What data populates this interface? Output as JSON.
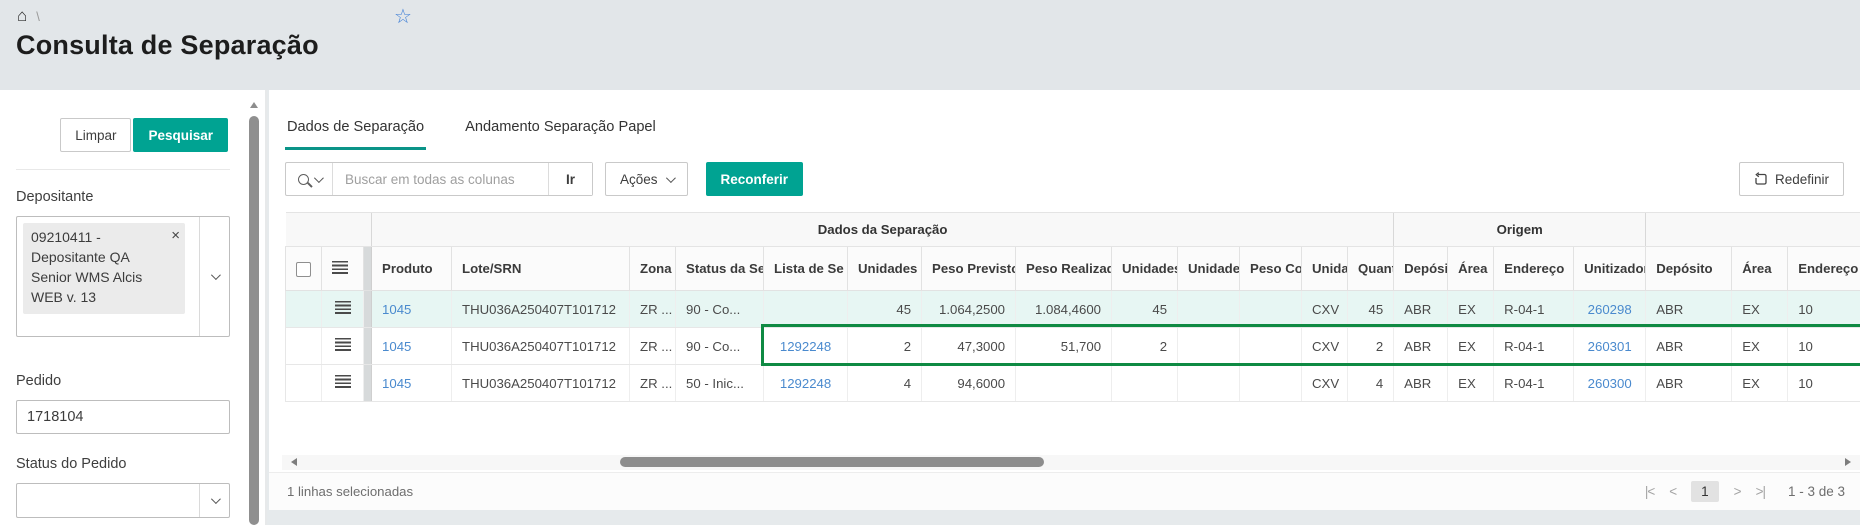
{
  "breadcrumb": {
    "separator": "\\"
  },
  "page": {
    "title": "Consulta de Separação"
  },
  "colors": {
    "accent_teal": "#00a392",
    "tab_underline": "#0a9488",
    "link_blue": "#4a8ace",
    "selection_outline_green": "#0f8a43",
    "selected_row_bg": "#e7f6f3",
    "header_bg": "#e2e6e9"
  },
  "sidebar": {
    "clear_label": "Limpar",
    "search_label": "Pesquisar",
    "depositante": {
      "label": "Depositante",
      "chip": "09210411 - Depositante QA Senior WMS Alcis WEB v. 13"
    },
    "pedido": {
      "label": "Pedido",
      "value": "1718104"
    },
    "status_pedido": {
      "label": "Status do Pedido",
      "value": ""
    }
  },
  "tabs": [
    {
      "label": "Dados de Separação",
      "active": true
    },
    {
      "label": "Andamento Separação Papel",
      "active": false
    }
  ],
  "toolbar": {
    "search_placeholder": "Buscar em todas as colunas",
    "go_label": "Ir",
    "actions_label": "Ações",
    "reconferir_label": "Reconferir",
    "redefinir_label": "Redefinir"
  },
  "table": {
    "groups": [
      {
        "label": "Dados da Separação"
      },
      {
        "label": "Origem"
      },
      {
        "label": ""
      }
    ],
    "columns": [
      {
        "key": "produto",
        "label": "Produto"
      },
      {
        "key": "lote_srn",
        "label": "Lote/SRN"
      },
      {
        "key": "zona",
        "label": "Zona d"
      },
      {
        "key": "status_sep",
        "label": "Status da Sep"
      },
      {
        "key": "lista_sep",
        "label": "Lista de Se"
      },
      {
        "key": "unidades_prev",
        "label": "Unidades P"
      },
      {
        "key": "peso_previsto",
        "label": "Peso Previsto."
      },
      {
        "key": "peso_realizado",
        "label": "Peso Realizado"
      },
      {
        "key": "unidades_conf",
        "label": "Unidades"
      },
      {
        "key": "unidades_2",
        "label": "Unidades"
      },
      {
        "key": "peso_conf",
        "label": "Peso Cor"
      },
      {
        "key": "unidade",
        "label": "Unidad"
      },
      {
        "key": "quantidade",
        "label": "Quant"
      },
      {
        "key": "deposito_origem",
        "label": "Depósit"
      },
      {
        "key": "area_origem",
        "label": "Área"
      },
      {
        "key": "endereco_origem",
        "label": "Endereço"
      },
      {
        "key": "unitizador",
        "label": "Unitizador"
      },
      {
        "key": "deposito_destino",
        "label": "Depósito"
      },
      {
        "key": "area_destino",
        "label": "Área"
      },
      {
        "key": "endereco_destino",
        "label": "Endereço"
      }
    ],
    "rows": [
      {
        "selected": true,
        "cells": {
          "produto": "1045",
          "lote_srn": "THU036A250407T101712",
          "zona": "ZR ...",
          "status_sep": "90 - Co...",
          "lista_sep": "",
          "unidades_prev": "45",
          "peso_previsto": "1.064,2500",
          "peso_realizado": "1.084,4600",
          "unidades_conf": "45",
          "unidades_2": "",
          "peso_conf": "",
          "unidade": "CXV",
          "quantidade": "45",
          "deposito_origem": "ABR",
          "area_origem": "EX",
          "endereco_origem": "R-04-1",
          "unitizador": "260298",
          "deposito_destino": "ABR",
          "area_destino": "EX",
          "endereco_destino": "10"
        }
      },
      {
        "selected": false,
        "highlighted": true,
        "cells": {
          "produto": "1045",
          "lote_srn": "THU036A250407T101712",
          "zona": "ZR ...",
          "status_sep": "90 - Co...",
          "lista_sep": "1292248",
          "unidades_prev": "2",
          "peso_previsto": "47,3000",
          "peso_realizado": "51,700",
          "unidades_conf": "2",
          "unidades_2": "",
          "peso_conf": "",
          "unidade": "CXV",
          "quantidade": "2",
          "deposito_origem": "ABR",
          "area_origem": "EX",
          "endereco_origem": "R-04-1",
          "unitizador": "260301",
          "deposito_destino": "ABR",
          "area_destino": "EX",
          "endereco_destino": "10"
        }
      },
      {
        "selected": false,
        "cells": {
          "produto": "1045",
          "lote_srn": "THU036A250407T101712",
          "zona": "ZR ...",
          "status_sep": "50 - Inic...",
          "lista_sep": "1292248",
          "unidades_prev": "4",
          "peso_previsto": "94,6000",
          "peso_realizado": "",
          "unidades_conf": "",
          "unidades_2": "",
          "peso_conf": "",
          "unidade": "CXV",
          "quantidade": "4",
          "deposito_origem": "ABR",
          "area_origem": "EX",
          "endereco_origem": "R-04-1",
          "unitizador": "260300",
          "deposito_destino": "ABR",
          "area_destino": "EX",
          "endereco_destino": "10"
        }
      }
    ]
  },
  "footer": {
    "selection_text": "1 linhas selecionadas",
    "pager": {
      "first": "|<",
      "prev": "<",
      "next": ">",
      "last": ">|"
    },
    "current_page": "1",
    "range_text": "1 - 3 de 3"
  }
}
